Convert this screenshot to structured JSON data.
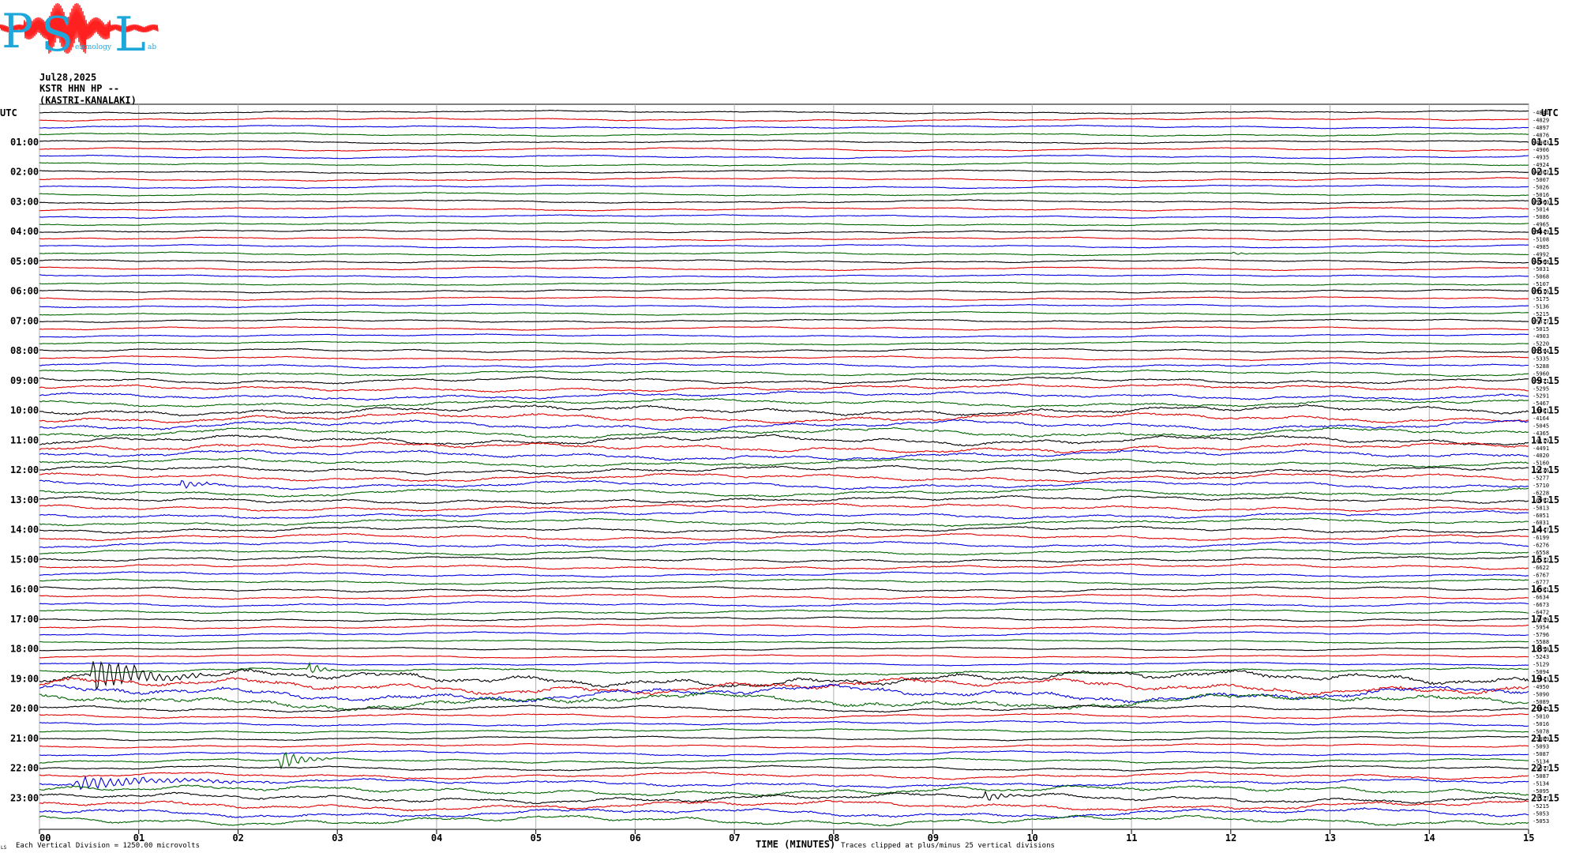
{
  "logo": {
    "letters": [
      "P",
      "S",
      "L"
    ],
    "text": "eismology",
    "text_tail": "ab",
    "colors": {
      "letters": "#1ea7d8",
      "wave": "#ff2020"
    }
  },
  "header": {
    "date": "Jul28,2025",
    "station": "KSTR HHN HP --",
    "location": "(KASTRI-KANALAKI)"
  },
  "chart_data": {
    "type": "line",
    "title": "",
    "xlabel": "TIME (MINUTES)",
    "ylabel": "",
    "xlim": [
      0,
      15
    ],
    "x_ticks": [
      "00",
      "01",
      "02",
      "03",
      "04",
      "05",
      "06",
      "07",
      "08",
      "09",
      "10",
      "11",
      "12",
      "13",
      "14",
      "15"
    ],
    "left_axis_label": "UTC",
    "right_axis_label": "UTC",
    "left_hour_labels": [
      "01:00",
      "02:00",
      "03:00",
      "04:00",
      "05:00",
      "06:00",
      "07:00",
      "08:00",
      "09:00",
      "10:00",
      "11:00",
      "12:00",
      "13:00",
      "14:00",
      "15:00",
      "16:00",
      "17:00",
      "18:00",
      "19:00",
      "20:00",
      "21:00",
      "22:00",
      "23:00"
    ],
    "right_hour_labels": [
      "01:15",
      "02:15",
      "03:15",
      "04:15",
      "05:15",
      "06:15",
      "07:15",
      "08:15",
      "09:15",
      "10:15",
      "11:15",
      "12:15",
      "13:15",
      "14:15",
      "15:15",
      "16:15",
      "17:15",
      "18:15",
      "19:15",
      "20:15",
      "21:15",
      "22:15",
      "23:15"
    ],
    "trace_colors": [
      "#000000",
      "#e00000",
      "#0000e0",
      "#006400"
    ],
    "trace_count": 96,
    "trace_means": [
      "-4841",
      "-4829",
      "-4897",
      "-4876",
      "-4903",
      "-4906",
      "-4935",
      "-4924",
      "-4902",
      "-5007",
      "-5026",
      "-5016",
      "-5060",
      "-5014",
      "-5086",
      "-4965",
      "-5049",
      "-5108",
      "-4985",
      "-4992",
      "-4968",
      "-5031",
      "-5068",
      "-5107",
      "-5116",
      "-5175",
      "-5136",
      "-5215",
      "-5077",
      "-5015",
      "-4903",
      "-5220",
      "-5194",
      "-5335",
      "-5288",
      "-5960",
      "-5471",
      "-5295",
      "-5291",
      "-5467",
      "-5081",
      "-4164",
      "-5045",
      "-4365",
      "-4119",
      "-4491",
      "-4020",
      "-5160",
      "-5136",
      "-5277",
      "-5710",
      "-6228",
      "-6092",
      "-5813",
      "-6051",
      "-6031",
      "-6447",
      "-6199",
      "-6276",
      "-6558",
      "-6532",
      "-6622",
      "-6767",
      "-6777",
      "-6581",
      "-6634",
      "-6673",
      "-6472",
      "-6199",
      "-5954",
      "-5796",
      "-5588",
      "-5358",
      "-5243",
      "-5129",
      "-5094",
      "-5043",
      "-4950",
      "-5090",
      "-5089",
      "-5045",
      "-5010",
      "-5016",
      "-5078",
      "-5089",
      "-5093",
      "-5087",
      "-5134",
      "-5077",
      "-5087",
      "-5134",
      "-5095",
      "-5127",
      "-5215",
      "-5053",
      "-5053"
    ],
    "amplitude_profile": [
      2,
      2,
      2,
      2,
      2,
      2,
      2,
      2,
      2,
      2,
      2,
      2,
      2,
      2,
      2,
      2,
      2,
      2,
      2,
      2,
      2,
      2,
      2,
      2,
      2,
      2,
      2,
      2,
      2,
      2,
      2,
      2,
      2.5,
      2.5,
      3,
      3.5,
      4,
      4.5,
      5,
      5,
      6,
      6,
      6,
      6,
      6,
      6,
      6,
      5,
      5,
      5,
      5,
      5,
      4.5,
      4.5,
      4.5,
      4.5,
      4,
      4,
      4,
      3.5,
      3.5,
      3.5,
      3,
      3,
      3,
      3,
      3,
      3,
      2.5,
      2.5,
      2.5,
      2,
      2,
      2,
      2,
      4,
      10,
      10,
      10,
      10,
      4,
      3,
      3,
      2.5,
      2.5,
      2.5,
      3,
      3,
      3,
      4,
      5,
      6,
      6,
      6,
      6,
      6
    ],
    "events": [
      {
        "trace": 50,
        "minute": 1.4,
        "amp": 9,
        "dur": 0.5
      },
      {
        "trace": 47,
        "minute": 2.0,
        "amp": 3,
        "dur": 0.3
      },
      {
        "trace": 87,
        "minute": 2.4,
        "amp": 18,
        "dur": 0.6
      },
      {
        "trace": 90,
        "minute": 0.3,
        "amp": 10,
        "dur": 2.5
      },
      {
        "trace": 92,
        "minute": 9.5,
        "amp": 10,
        "dur": 0.5
      },
      {
        "trace": 76,
        "minute": 0.5,
        "amp": 30,
        "dur": 1.2
      },
      {
        "trace": 75,
        "minute": 2.7,
        "amp": 12,
        "dur": 0.3
      },
      {
        "trace": 19,
        "minute": 12.0,
        "amp": 3,
        "dur": 0.3
      }
    ],
    "grid": true,
    "legend": "none"
  },
  "footer": {
    "scale_note": "Each Vertical Division = 1250.00 microvolts",
    "clip_note": "Traces clipped at plus/minus 25 vertical divisions",
    "corner_mark": "LS"
  }
}
